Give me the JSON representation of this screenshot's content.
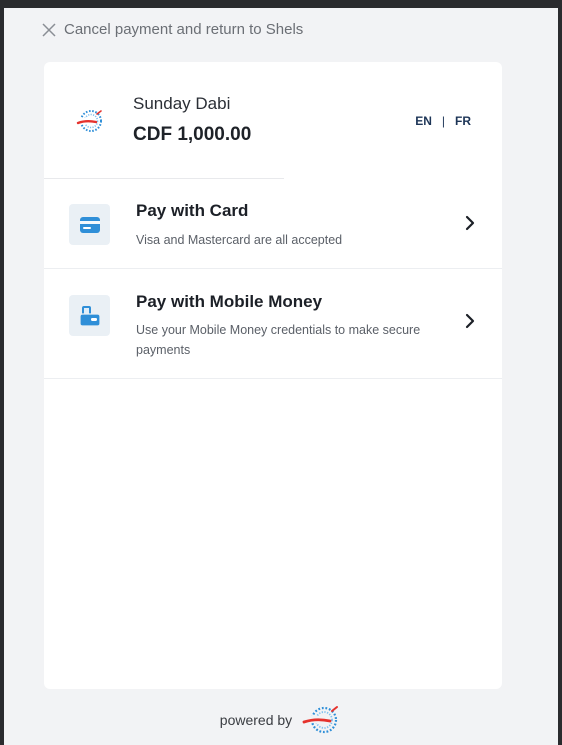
{
  "cancel": {
    "icon": "close-icon",
    "label": "Cancel payment and return to Shels"
  },
  "merchant": {
    "logo_icon": "maxicash-logo",
    "name": "Sunday Dabi",
    "amount": "CDF 1,000.00"
  },
  "language": {
    "options": [
      "EN",
      "FR"
    ],
    "separator": "|"
  },
  "payment_options": [
    {
      "icon": "credit-card-icon",
      "title": "Pay with Card",
      "description": "Visa and Mastercard are all accepted"
    },
    {
      "icon": "mobile-wallet-icon",
      "title": "Pay with Mobile Money",
      "description": "Use your Mobile Money credentials to make secure payments"
    }
  ],
  "footer": {
    "powered_by": "powered by",
    "logo_icon": "maxicash-logo"
  },
  "colors": {
    "accent": "#2f8fd8",
    "icon_bg": "#eaf0f5",
    "page_bg": "#f2f3f5",
    "brand_red": "#e5322d"
  }
}
